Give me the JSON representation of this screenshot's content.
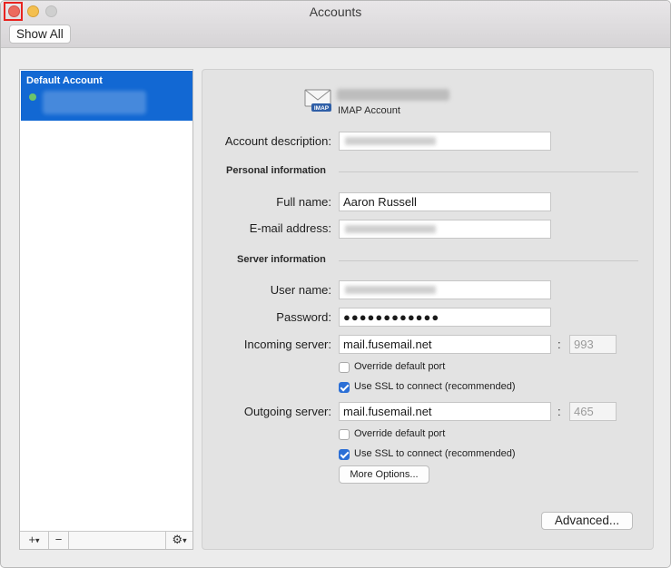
{
  "window": {
    "title": "Accounts",
    "show_all_label": "Show All"
  },
  "sidebar": {
    "accounts": [
      {
        "name": "Default Account",
        "status": "online",
        "status_color": "#6cc46a"
      }
    ],
    "footer": {
      "add_label": "+",
      "remove_label": "−",
      "gear_icon": "gear-icon"
    }
  },
  "colors": {
    "selection": "#1268d3",
    "checkbox_on": "#2b6fd6",
    "close_highlight": "#e8231f"
  },
  "account": {
    "type": "IMAP Account",
    "icon": "imap-envelope-icon",
    "description_label": "Account description:",
    "personal_section": "Personal information",
    "full_name_label": "Full name:",
    "full_name_value": "Aaron Russell",
    "email_label": "E-mail address:",
    "server_section": "Server information",
    "username_label": "User name:",
    "password_label": "Password:",
    "password_value": "●●●●●●●●●●●●",
    "incoming_label": "Incoming server:",
    "incoming_value": "mail.fusemail.net",
    "incoming_port": "993",
    "incoming_override_label": "Override default port",
    "incoming_override_checked": false,
    "incoming_ssl_label": "Use SSL to connect (recommended)",
    "incoming_ssl_checked": true,
    "outgoing_label": "Outgoing server:",
    "outgoing_value": "mail.fusemail.net",
    "outgoing_port": "465",
    "outgoing_override_label": "Override default port",
    "outgoing_override_checked": false,
    "outgoing_ssl_label": "Use SSL to connect (recommended)",
    "outgoing_ssl_checked": true,
    "more_options_label": "More Options...",
    "advanced_label": "Advanced...",
    "colon": ":"
  }
}
